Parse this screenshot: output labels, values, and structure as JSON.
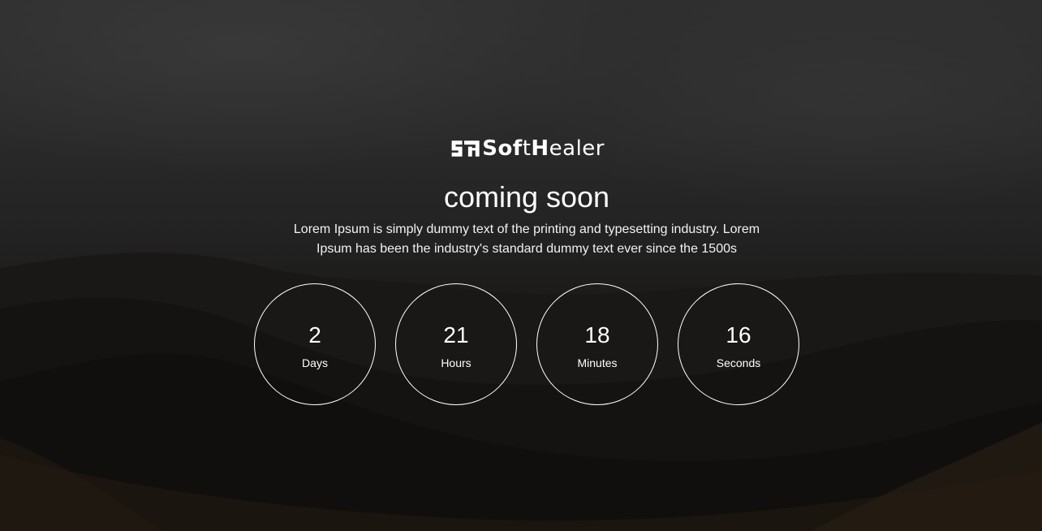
{
  "brand": {
    "logo_text_1": "Sof",
    "logo_text_2": "t",
    "logo_text_3": "H",
    "logo_text_4": "ealer"
  },
  "hero": {
    "title": "coming soon",
    "description": "Lorem Ipsum is simply dummy text of the printing and typesetting industry. Lorem Ipsum has been the industry's standard dummy text ever since the 1500s"
  },
  "countdown": [
    {
      "value": "2",
      "unit": "Days"
    },
    {
      "value": "21",
      "unit": "Hours"
    },
    {
      "value": "18",
      "unit": "Minutes"
    },
    {
      "value": "16",
      "unit": "Seconds"
    }
  ],
  "colors": {
    "text": "#ffffff",
    "background": "#1c1a18",
    "ring": "#ffffff"
  },
  "icons": {
    "logo_mark": "softhealer-logo-icon"
  }
}
